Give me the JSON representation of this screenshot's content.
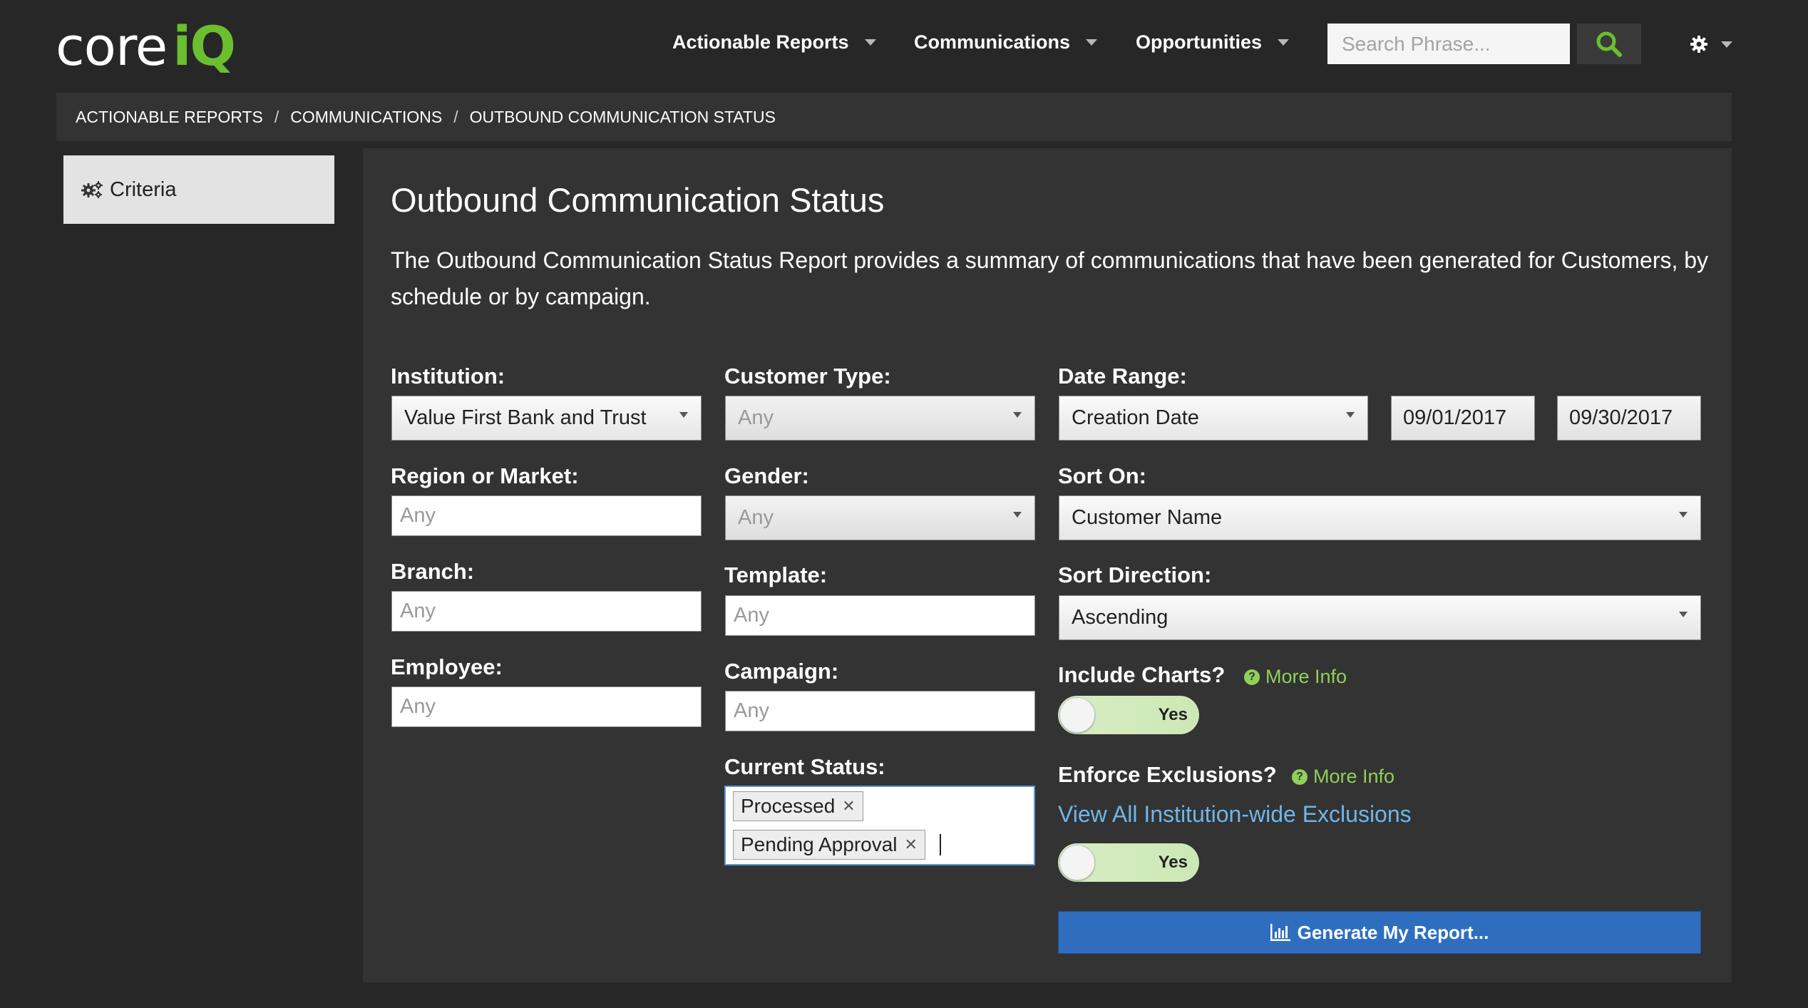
{
  "header": {
    "logo_core": "core",
    "logo_iq": "iQ",
    "nav": [
      {
        "label": "Actionable Reports"
      },
      {
        "label": "Communications"
      },
      {
        "label": "Opportunities"
      }
    ],
    "search_placeholder": "Search Phrase...",
    "search_icon": "search-icon",
    "settings_icon": "gear-icon"
  },
  "breadcrumb": {
    "items": [
      "ACTIONABLE REPORTS",
      "COMMUNICATIONS",
      "OUTBOUND COMMUNICATION STATUS"
    ],
    "separator": "/"
  },
  "sidebar": {
    "criteria_label": "Criteria",
    "criteria_icon": "gears-icon"
  },
  "main": {
    "title": "Outbound Communication Status",
    "description": "The Outbound Communication Status Report provides a summary of communications that have been generated for Customers, by schedule or by campaign.",
    "fields": {
      "institution": {
        "label": "Institution:",
        "value": "Value First Bank and Trust"
      },
      "region": {
        "label": "Region or Market:",
        "placeholder": "Any"
      },
      "branch": {
        "label": "Branch:",
        "placeholder": "Any"
      },
      "employee": {
        "label": "Employee:",
        "placeholder": "Any"
      },
      "customer_type": {
        "label": "Customer Type:",
        "value": "Any"
      },
      "gender": {
        "label": "Gender:",
        "value": "Any"
      },
      "template": {
        "label": "Template:",
        "placeholder": "Any"
      },
      "campaign": {
        "label": "Campaign:",
        "placeholder": "Any"
      },
      "current_status": {
        "label": "Current Status:",
        "tags": [
          "Processed",
          "Pending Approval"
        ]
      },
      "date_range": {
        "label": "Date Range:",
        "value": "Creation Date",
        "start": "09/01/2017",
        "end": "09/30/2017"
      },
      "sort_on": {
        "label": "Sort On:",
        "value": "Customer Name"
      },
      "sort_direction": {
        "label": "Sort Direction:",
        "value": "Ascending"
      },
      "include_charts": {
        "label": "Include Charts?",
        "more_info": "More Info",
        "toggle": "Yes"
      },
      "enforce_exclusions": {
        "label": "Enforce Exclusions?",
        "more_info": "More Info",
        "link": "View All Institution-wide Exclusions",
        "toggle": "Yes"
      }
    },
    "generate_button": "Generate My Report...",
    "generate_icon": "bar-chart-icon"
  },
  "colors": {
    "background": "#272727",
    "panel": "#333333",
    "accent_green": "#6bbf2f",
    "link_blue": "#6fb6e8",
    "button_blue": "#2f6ebf"
  }
}
